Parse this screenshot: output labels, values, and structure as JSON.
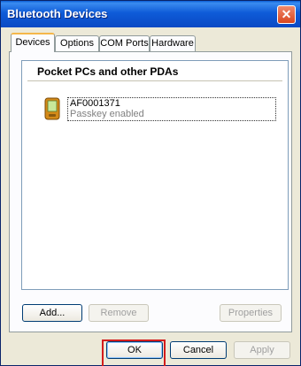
{
  "window": {
    "title": "Bluetooth Devices"
  },
  "tabs": [
    {
      "label": "Devices",
      "active": true
    },
    {
      "label": "Options",
      "active": false
    },
    {
      "label": "COM Ports",
      "active": false
    },
    {
      "label": "Hardware",
      "active": false
    }
  ],
  "devices": {
    "group_header": "Pocket PCs and other PDAs",
    "items": [
      {
        "name": "AF0001371",
        "status": "Passkey enabled",
        "icon": "pda-icon"
      }
    ]
  },
  "panel_buttons": {
    "add": "Add...",
    "remove": "Remove",
    "properties": "Properties"
  },
  "dialog_buttons": {
    "ok": "OK",
    "cancel": "Cancel",
    "apply": "Apply"
  },
  "colors": {
    "titlebar": "#0a5ed7",
    "highlight_box": "#d41c1c",
    "active_tab_accent": "#f5b74a"
  }
}
